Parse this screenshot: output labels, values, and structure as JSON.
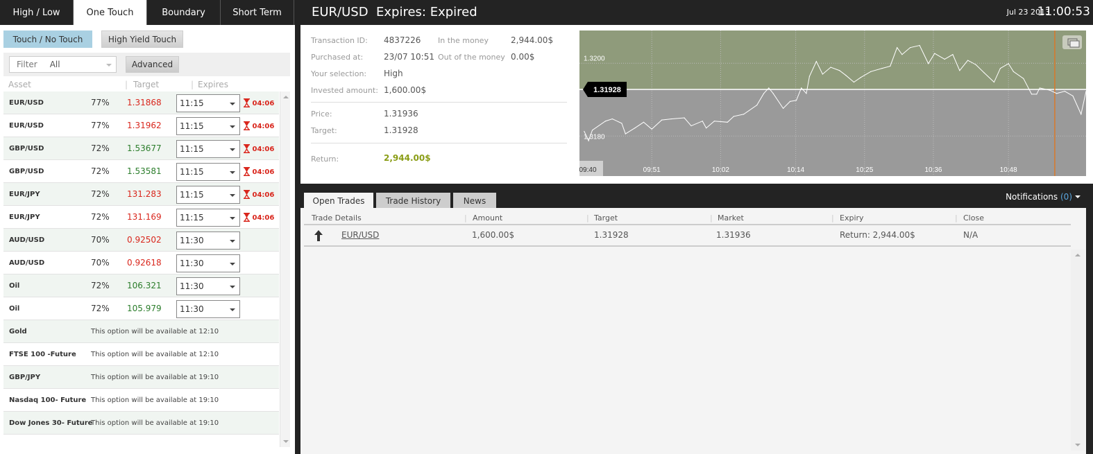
{
  "left": {
    "tabs": [
      "High / Low",
      "One Touch",
      "Boundary",
      "Short Term"
    ],
    "active_tab": 1,
    "sub_buttons": {
      "touch": "Touch / No Touch",
      "high_yield": "High Yield Touch"
    },
    "filter": {
      "label": "Filter",
      "value": "All"
    },
    "advanced": "Advanced",
    "columns": {
      "asset": "Asset",
      "target": "Target",
      "expires": "Expires"
    },
    "rows": [
      {
        "asset": "EUR/USD",
        "pct": "77%",
        "target": "1.31868",
        "color": "red",
        "expires": "11:15",
        "timer": "04:06"
      },
      {
        "asset": "EUR/USD",
        "pct": "77%",
        "target": "1.31962",
        "color": "red",
        "expires": "11:15",
        "timer": "04:06"
      },
      {
        "asset": "GBP/USD",
        "pct": "72%",
        "target": "1.53677",
        "color": "green",
        "expires": "11:15",
        "timer": "04:06"
      },
      {
        "asset": "GBP/USD",
        "pct": "72%",
        "target": "1.53581",
        "color": "green",
        "expires": "11:15",
        "timer": "04:06"
      },
      {
        "asset": "EUR/JPY",
        "pct": "72%",
        "target": "131.283",
        "color": "red",
        "expires": "11:15",
        "timer": "04:06"
      },
      {
        "asset": "EUR/JPY",
        "pct": "72%",
        "target": "131.169",
        "color": "red",
        "expires": "11:15",
        "timer": "04:06"
      },
      {
        "asset": "AUD/USD",
        "pct": "70%",
        "target": "0.92502",
        "color": "red",
        "expires": "11:30"
      },
      {
        "asset": "AUD/USD",
        "pct": "70%",
        "target": "0.92618",
        "color": "red",
        "expires": "11:30"
      },
      {
        "asset": "Oil",
        "pct": "72%",
        "target": "106.321",
        "color": "green",
        "expires": "11:30"
      },
      {
        "asset": "Oil",
        "pct": "72%",
        "target": "105.979",
        "color": "green",
        "expires": "11:30"
      },
      {
        "asset": "Gold",
        "note": "This option will be available at 12:10"
      },
      {
        "asset": "FTSE 100 -Future",
        "note": "This option will be available at 12:10"
      },
      {
        "asset": "GBP/JPY",
        "note": "This option will be available at 19:10"
      },
      {
        "asset": "Nasdaq 100- Future",
        "note": "This option will be available at 19:10"
      },
      {
        "asset": "Dow Jones 30- Future",
        "note": "This option will be available at 19:10"
      }
    ]
  },
  "header": {
    "title": "EUR/USD  Expires: Expired",
    "date": "Jul 23 2013",
    "time": "11:00:53"
  },
  "info": {
    "transaction_id_label": "Transaction ID:",
    "transaction_id": "4837226",
    "purchased_label": "Purchased at:",
    "purchased": "23/07 10:51",
    "selection_label": "Your selection:",
    "selection": "High",
    "invested_label": "Invested amount:",
    "invested": "1,600.00$",
    "itm_label": "In the money",
    "itm": "2,944.00$",
    "otm_label": "Out of the money",
    "otm": "0.00$",
    "price_label": "Price:",
    "price": "1.31936",
    "target_label": "Target:",
    "target": "1.31928",
    "return_label": "Return:",
    "return": "2,944.00$"
  },
  "chart_data": {
    "type": "line",
    "title": "EUR/USD",
    "x_unit": "minutes since 09:40",
    "x_tick_labels": [
      "09:40",
      "09:51",
      "10:02",
      "10:14",
      "10:25",
      "10:36",
      "10:48"
    ],
    "x_tick_values": [
      0,
      11,
      22,
      34,
      45,
      56,
      68
    ],
    "xlim": [
      0,
      80.4
    ],
    "y_tick_labels": [
      "1.3200",
      "1.3180"
    ],
    "y_tick_values": [
      1.32,
      1.318
    ],
    "ylim": [
      1.3169,
      1.3209
    ],
    "target": 1.31928,
    "target_label": "1.31928",
    "expiry_x": 75.4,
    "colors": {
      "above": "#8f9b7b",
      "below": "#9a9a9a",
      "line": "#ffffff",
      "expiry": "#d8782a"
    },
    "x": [
      0.2,
      0.9,
      1.5,
      3.6,
      4.7,
      6.2,
      6.8,
      8.3,
      9.7,
      11.0,
      12.6,
      14.1,
      16.2,
      17.3,
      19.1,
      19.7,
      21.0,
      23.1,
      24.1,
      25.7,
      27.8,
      28.9,
      29.7,
      30.4,
      32.0,
      33.1,
      34.1,
      34.9,
      35.7,
      36.2,
      37.3,
      38.3,
      39.6,
      41.0,
      42.0,
      43.3,
      44.4,
      46.0,
      47.8,
      49.1,
      50.2,
      51.0,
      52.3,
      53.8,
      55.2,
      56.2,
      57.8,
      59.1,
      60.2,
      61.5,
      62.8,
      64.1,
      65.7,
      66.7,
      68.0,
      68.8,
      70.4,
      71.7,
      72.5,
      73.0,
      74.6,
      75.7,
      77.0,
      78.3,
      79.6,
      80.4
    ],
    "y": [
      1.31813,
      1.31787,
      1.31816,
      1.31841,
      1.31847,
      1.31835,
      1.31806,
      1.31822,
      1.31838,
      1.31819,
      1.31844,
      1.31847,
      1.3185,
      1.31828,
      1.31841,
      1.31822,
      1.31841,
      1.31838,
      1.31854,
      1.3186,
      1.31885,
      1.31917,
      1.31932,
      1.31917,
      1.31876,
      1.31895,
      1.31898,
      1.31932,
      1.31917,
      1.31964,
      1.32005,
      1.3197,
      1.31989,
      1.3198,
      1.31967,
      1.31948,
      1.31961,
      1.31977,
      1.31986,
      1.31992,
      1.32043,
      1.32024,
      1.32043,
      1.32049,
      1.31999,
      1.32027,
      1.32011,
      1.32024,
      1.3198,
      1.32008,
      1.31996,
      1.31974,
      1.31948,
      1.31986,
      1.31999,
      1.31977,
      1.31958,
      1.31915,
      1.31915,
      1.31932,
      1.31926,
      1.31917,
      1.31923,
      1.3191,
      1.3186,
      1.31923
    ]
  },
  "bottom": {
    "tabs": [
      "Open Trades",
      "Trade History",
      "News"
    ],
    "notifications": "Notifications",
    "notif_count": "(0)",
    "columns": [
      "Trade Details",
      "Amount",
      "Target",
      "Market",
      "Expiry",
      "Close"
    ],
    "trade": {
      "asset": "EUR/USD",
      "amount": "1,600.00$",
      "target": "1.31928",
      "market": "1.31936",
      "expiry": "Return: 2,944.00$",
      "close": "N/A"
    }
  }
}
